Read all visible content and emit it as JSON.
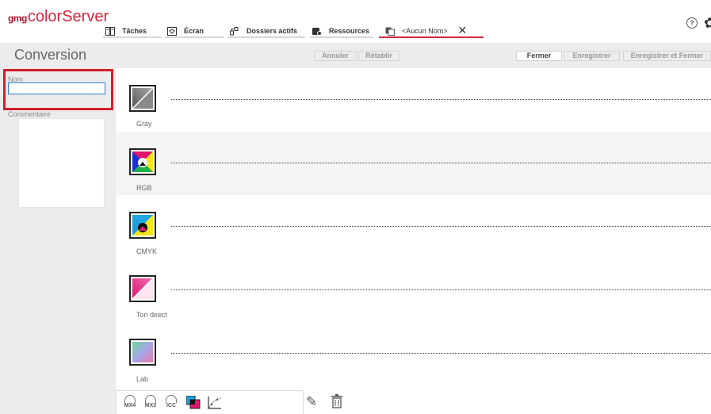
{
  "app": {
    "logo_prefix": "gmg",
    "logo_name": "colorServer"
  },
  "tabs": [
    {
      "label": "Tâches",
      "icon": "tasks-icon"
    },
    {
      "label": "Écran",
      "icon": "screen-icon"
    },
    {
      "label": "Dossiers actifs",
      "icon": "hotfolders-icon"
    },
    {
      "label": "Ressources",
      "icon": "resources-icon"
    },
    {
      "label": "<Aucun Nom>",
      "icon": "document-icon",
      "active": true
    }
  ],
  "header": {
    "title": "Conversion",
    "annuler": "Annuler",
    "retablir": "Rétablir",
    "fermer": "Fermer",
    "enregistrer": "Enregistrer",
    "enregistrer_fermer": "Enregistrer et Fermer"
  },
  "form": {
    "nom_label": "Nom",
    "nom_value": "",
    "comment_label": "Commentaire",
    "comment_value": ""
  },
  "rows": [
    {
      "label": "Gray",
      "icon": "gray-colorspace-icon"
    },
    {
      "label": "RGB",
      "icon": "rgb-colorspace-icon"
    },
    {
      "label": "CMYK",
      "icon": "cmyk-colorspace-icon"
    },
    {
      "label": "Ton direct",
      "icon": "spot-color-icon"
    },
    {
      "label": "Lab",
      "icon": "lab-colorspace-icon"
    }
  ],
  "toolbar": {
    "mx4": "MX4",
    "mx3": "MX3",
    "icc": "ICC"
  },
  "colors": {
    "accent": "#d6273f",
    "highlight": "#d0202b",
    "panel": "#ececec"
  }
}
